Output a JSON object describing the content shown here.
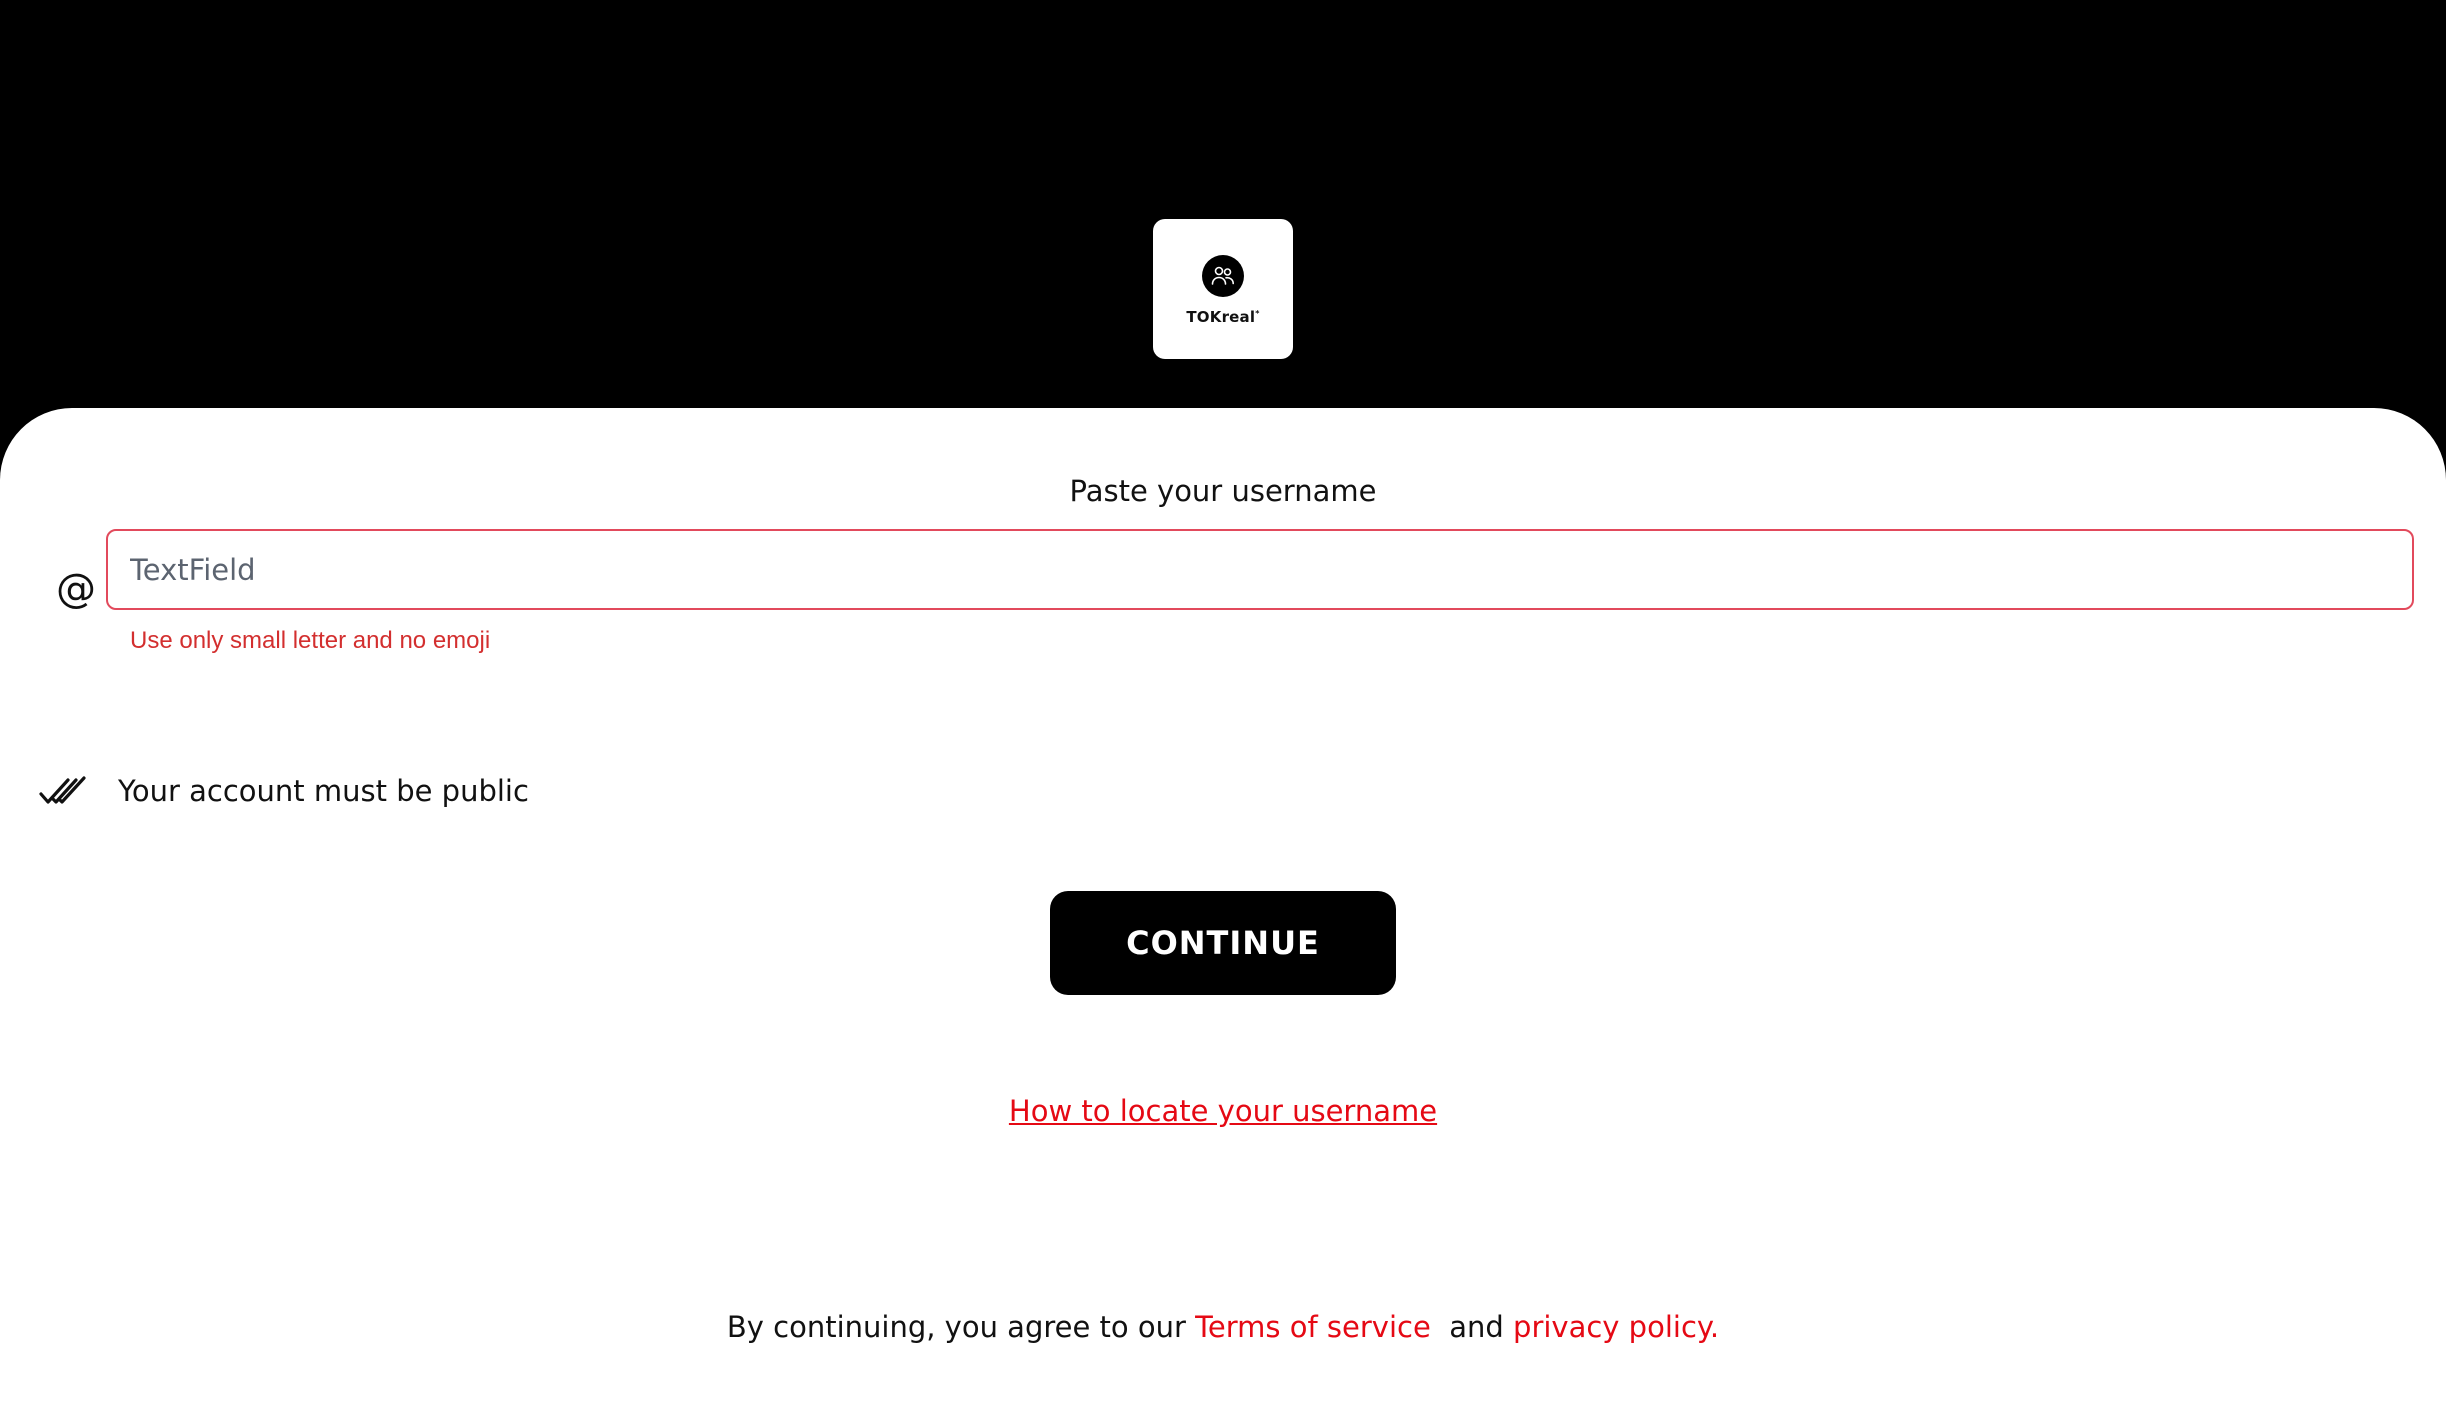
{
  "header": {
    "logo_text": "TOKreal",
    "logo_mark": "*"
  },
  "form": {
    "prompt_label": "Paste your username",
    "at_prefix": "@",
    "username_placeholder": "TextField",
    "username_value": "",
    "error_message": "Use only small letter and no emoji"
  },
  "requirements": [
    {
      "icon": "double-check-icon",
      "text": "Your account must be public"
    }
  ],
  "actions": {
    "continue_label": "CONTINUE",
    "help_link_label": "How to locate your username"
  },
  "footer": {
    "agree_prefix": "By continuing, you agree to our",
    "terms_label": "Terms of service",
    "and_text": "and",
    "privacy_label": "privacy policy."
  },
  "colors": {
    "background_top": "#000000",
    "sheet": "#ffffff",
    "accent_red": "#e50914",
    "error_red": "#d32f2f",
    "input_border": "#e24a5c",
    "button": "#000000"
  }
}
